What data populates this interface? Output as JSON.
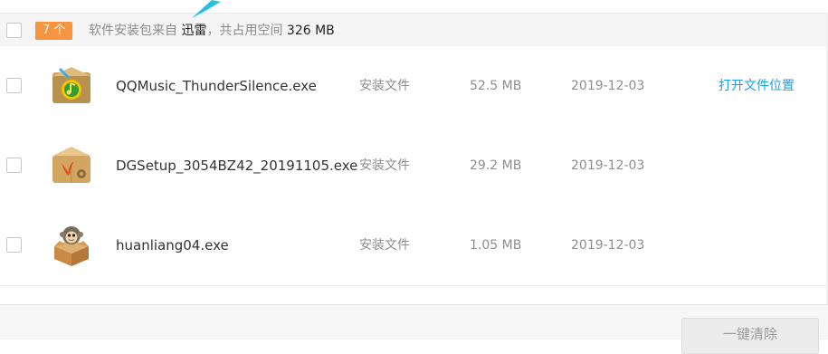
{
  "header": {
    "count_badge": "7 个",
    "summary_prefix": "软件安装包来自",
    "source_name": "迅雷",
    "summary_middle": "，共占用空间",
    "total_size": "326 MB"
  },
  "files": [
    {
      "name": "QQMusic_ThunderSilence.exe",
      "type": "安装文件",
      "size": "52.5 MB",
      "date": "2019-12-03",
      "action": "打开文件位置",
      "icon": "qqmusic-package-icon"
    },
    {
      "name": "DGSetup_3054BZ42_20191105.exe",
      "type": "安装文件",
      "size": "29.2 MB",
      "date": "2019-12-03",
      "action": "",
      "icon": "dg-setup-package-icon"
    },
    {
      "name": "huanliang04.exe",
      "type": "安装文件",
      "size": "1.05 MB",
      "date": "2019-12-03",
      "action": "",
      "icon": "monkey-package-icon"
    }
  ],
  "footer": {
    "clean_button_label": "一键清除"
  },
  "colors": {
    "badge": "#f6943f",
    "link": "#1a9fe0",
    "pointer": "#29c0e0"
  }
}
